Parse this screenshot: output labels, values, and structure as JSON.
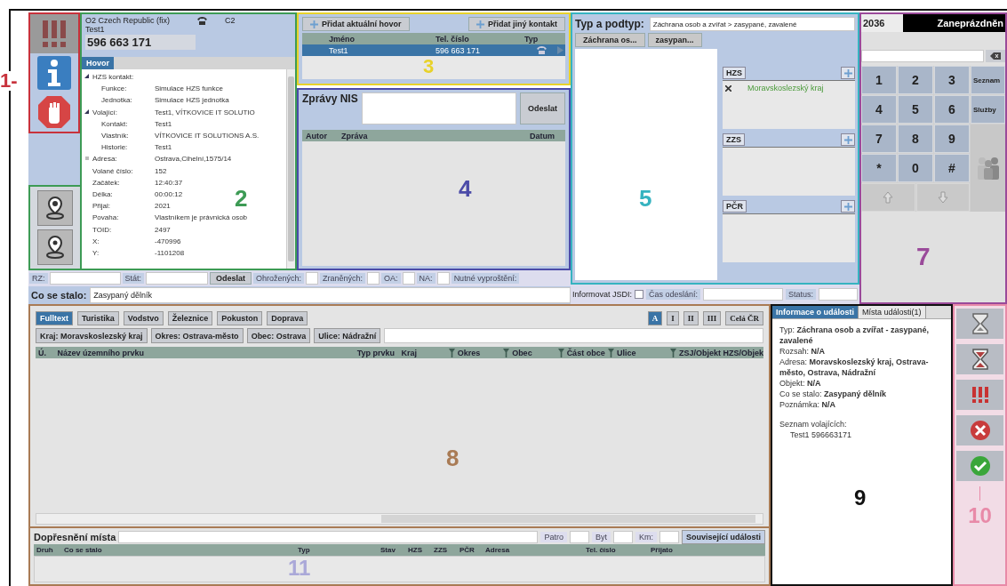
{
  "alerts": {
    "annotation": {
      "text": "1-",
      "color": "#c8323c"
    }
  },
  "call_info": {
    "annotation": {
      "text": "2",
      "color": "#3d9b55"
    },
    "operator": "O2 Czech Republic (fix)",
    "line": "C2",
    "caller": "Test1",
    "number": "596 663 171",
    "tabs": [
      {
        "label": "Hovor",
        "selected": true
      }
    ],
    "properties": [
      {
        "label": "HZS kontakt:",
        "expanded": true,
        "children": [
          {
            "label": "Funkce:",
            "value": "Simulace HZS funkce"
          },
          {
            "label": "Jednotka:",
            "value": "Simulace HZS jednotka"
          }
        ]
      },
      {
        "label": "Volající:",
        "value": "Test1, VÍTKOVICE IT SOLUTIO",
        "expanded": true,
        "children": [
          {
            "label": "Kontakt:",
            "value": "Test1"
          },
          {
            "label": "Vlastník:",
            "value": "VÍTKOVICE IT SOLUTIONS A.S."
          },
          {
            "label": "Historie:",
            "value": "Test1"
          }
        ]
      },
      {
        "label": "Adresa:",
        "value": "Ostrava,Cihelní,1575/14",
        "expanded": false
      },
      {
        "label": "Volané číslo:",
        "value": "152"
      },
      {
        "label": "Začátek:",
        "value": "12:40:37"
      },
      {
        "label": "Délka:",
        "value": "00:00:12"
      },
      {
        "label": "Přijal:",
        "value": "2021"
      },
      {
        "label": "Povaha:",
        "value": "Vlastníkem je právnická osob"
      },
      {
        "label": "TOID:",
        "value": "2497"
      },
      {
        "label": "X:",
        "value": "-470996"
      },
      {
        "label": "Y:",
        "value": "-1101208"
      }
    ]
  },
  "contacts": {
    "annotation": {
      "text": "3",
      "color": "#e8d22a"
    },
    "buttons": [
      "Přidat aktuální hovor",
      "Přidat jiný kontakt"
    ],
    "columns": [
      "Jméno",
      "Tel. číslo",
      "Typ"
    ],
    "rows": [
      {
        "name": "Test1",
        "phone": "596 663 171",
        "selected": true
      }
    ]
  },
  "nis": {
    "annotation": {
      "text": "4",
      "color": "#4b4ba8"
    },
    "title": "Zprávy NIS",
    "send": "Odeslat",
    "columns": [
      "Autor",
      "Zpráva",
      "Datum"
    ]
  },
  "vehicle": {
    "fields": [
      "RZ:",
      "Stát:"
    ],
    "send": "Odeslat"
  },
  "casualties": [
    "Ohrožených:",
    "Zraněných:",
    "OA:",
    "NA:",
    "Nutné vyproštění:"
  ],
  "what_happened": {
    "label": "Co se stalo:",
    "value": "Zasypaný dělník"
  },
  "incident_type": {
    "annotation": {
      "text": "5",
      "color": "#36b3c0"
    },
    "label": "Typ a podtyp:",
    "value": "Záchrana osob a zvířat > zasypané, zavalené",
    "path": [
      "Záchrana os...",
      "zasypan..."
    ],
    "units": [
      {
        "name": "HZS",
        "items": [
          "Moravskoslezský kraj"
        ]
      },
      {
        "name": "ZZS"
      },
      {
        "name": "PČR"
      }
    ]
  },
  "notify": {
    "label": "Informovat JSDI:",
    "checked": false,
    "time_label": "Čas odeslání:",
    "status_label": "Status:"
  },
  "phone": {
    "annotation": {
      "text": "7",
      "color": "#9a4a9a"
    },
    "extension": "2036",
    "status": "Zaneprázdněn",
    "keys": [
      "1",
      "2",
      "3",
      "4",
      "5",
      "6",
      "7",
      "8",
      "9",
      "*",
      "0",
      "#"
    ],
    "side": [
      "Seznam",
      "Služby"
    ]
  },
  "locality": {
    "annotation": {
      "text": "8",
      "color": "#a97b55"
    },
    "tabs": [
      {
        "label": "Fulltext",
        "selected": true
      },
      {
        "label": "Turistika",
        "selected": false
      },
      {
        "label": "Vodstvo",
        "selected": false
      },
      {
        "label": "Železnice",
        "selected": false
      },
      {
        "label": "Pokuston",
        "selected": false
      },
      {
        "label": "Doprava",
        "selected": false
      }
    ],
    "levels": [
      {
        "label": "A",
        "selected": true
      },
      {
        "label": "I",
        "selected": false
      },
      {
        "label": "II",
        "selected": false
      },
      {
        "label": "III",
        "selected": false
      },
      {
        "label": "Celá ČR",
        "selected": false
      }
    ],
    "filters": [
      "Kraj: Moravskoslezský kraj",
      "Okres: Ostrava-město",
      "Obec: Ostrava",
      "Ulice: Nádražní"
    ],
    "columns": [
      {
        "label": "Ú.",
        "filter": false
      },
      {
        "label": "Název územního prvku",
        "filter": false
      },
      {
        "label": "Typ prvku",
        "filter": false
      },
      {
        "label": "Kraj",
        "filter": false
      },
      {
        "label": "Okres",
        "filter": true
      },
      {
        "label": "Obec",
        "filter": true
      },
      {
        "label": "Část obce",
        "filter": true
      },
      {
        "label": "Ulice",
        "filter": true
      },
      {
        "label": "ZSJ/Objekt HZS/Objek",
        "filter": true
      }
    ]
  },
  "detail": {
    "annotation": {
      "text": "11",
      "color": "#aaa8d8"
    },
    "title": "Dopřesnění místa",
    "fields": [
      "Patro",
      "Byt",
      "Km:"
    ],
    "button": "Související události",
    "columns": [
      "Druh",
      "Co se stalo",
      "Typ",
      "Stav",
      "HZS",
      "ZZS",
      "PČR",
      "Adresa",
      "Tel. číslo",
      "Přijato"
    ]
  },
  "event_info": {
    "annotation": {
      "text": "9",
      "color": "#111111"
    },
    "tabs": [
      {
        "label": "Informace o události",
        "selected": true
      },
      {
        "label": "Místa události(1)",
        "selected": false
      }
    ],
    "lines": [
      "Typ: **Záchrana osob a zvířat - zasypané, zavalené**",
      "Rozsah: **N/A**",
      "Adresa: **Moravskoslezský kraj, Ostrava-město, Ostrava, Nádražní**",
      "Objekt: **N/A**",
      "Co se stalo: **Zasypaný dělník**",
      "Poznámka: **N/A**"
    ],
    "callers_label": "Seznam volajících:",
    "callers": [
      "Test1 596663171"
    ]
  },
  "actions": {
    "annotation": {
      "text": "10",
      "color": "#e88aa8"
    },
    "buttons": [
      {
        "kind": "hourglass"
      },
      {
        "kind": "hourglass_red"
      },
      {
        "kind": "urgent"
      },
      {
        "kind": "cancel"
      },
      {
        "kind": "confirm"
      }
    ]
  }
}
